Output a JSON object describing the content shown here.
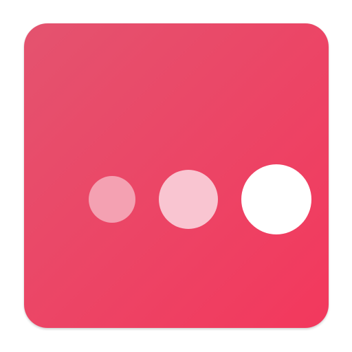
{
  "icon": {
    "name": "ellipsis-dots-app-icon",
    "gradient_start": "#E4536F",
    "gradient_end": "#F3385D",
    "dots": [
      {
        "name": "dot-small",
        "color": "#F4A1B2"
      },
      {
        "name": "dot-medium",
        "color": "#F9C5D1"
      },
      {
        "name": "dot-large",
        "color": "#FFFFFF"
      }
    ]
  }
}
